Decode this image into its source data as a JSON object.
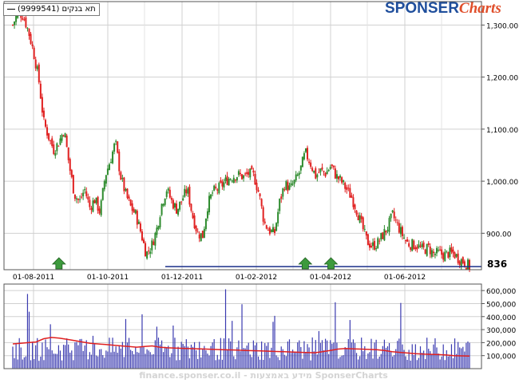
{
  "legend": {
    "label": "תא בנקים (9999541)"
  },
  "logo": {
    "part1": "SPONSER",
    "part2": "Charts"
  },
  "watermark": "finance.sponser.co.il - מידע באמצעות SponserCharts",
  "last_price_label": "836",
  "chart_data": [
    {
      "type": "candlestick",
      "name": "price",
      "title": "",
      "x_tick_labels": [
        "01-08-2011",
        "01-10-2011",
        "01-12-2011",
        "01-02-2012",
        "01-04-2012",
        "01-06-2012"
      ],
      "y_tick_labels": [
        "1,300.00",
        "1,200.00",
        "1,100.00",
        "1,000.00",
        "900.00"
      ],
      "y_ticks": [
        1300,
        1200,
        1100,
        1000,
        900
      ],
      "ylim": [
        830,
        1345
      ],
      "grid": true,
      "colors": {
        "up": "#2e8b2e",
        "down": "#e02020",
        "support_line": "#1a2f8a",
        "arrow": "#3d9a3d"
      },
      "support_line_value": 836,
      "arrows_at_index": [
        9,
        57,
        62
      ],
      "approx_close_path": [
        1300,
        1325,
        1318,
        1290,
        1250,
        1200,
        1115,
        1085,
        1060,
        1075,
        1100,
        1030,
        975,
        960,
        985,
        950,
        965,
        940,
        1010,
        1040,
        1075,
        1010,
        975,
        950,
        935,
        900,
        860,
        875,
        905,
        955,
        985,
        960,
        945,
        965,
        985,
        935,
        900,
        895,
        955,
        980,
        985,
        995,
        1005,
        1010,
        1012,
        1008,
        1015,
        1010,
        975,
        920,
        905,
        900,
        960,
        995,
        985,
        1000,
        1020,
        1055,
        1035,
        1010,
        1020,
        1015,
        1030,
        1010,
        1000,
        985,
        970,
        945,
        915,
        885,
        875,
        880,
        895,
        910,
        935,
        915,
        895,
        880,
        878,
        875,
        868,
        872,
        860,
        862,
        858,
        862,
        860,
        850,
        845,
        836
      ]
    },
    {
      "type": "bar+line",
      "name": "volume",
      "y_tick_labels": [
        "600,000",
        "500,000",
        "400,000",
        "300,000",
        "200,000",
        "100,000"
      ],
      "y_ticks": [
        600000,
        500000,
        400000,
        300000,
        200000,
        100000
      ],
      "ylim": [
        0,
        650000
      ],
      "grid": true,
      "colors": {
        "bars": "#3a3ab0",
        "moving_average": "#e02020"
      },
      "approx_moving_average_path": [
        190000,
        195000,
        200000,
        205000,
        230000,
        240000,
        235000,
        225000,
        215000,
        205000,
        195000,
        190000,
        185000,
        180000,
        175000,
        170000,
        165000,
        170000,
        175000,
        165000,
        160000,
        158000,
        156000,
        154000,
        152000,
        150000,
        148000,
        146000,
        144000,
        142000,
        140000,
        138000,
        136000,
        134000,
        132000,
        130000,
        128000,
        126000,
        124000,
        122000,
        130000,
        140000,
        150000,
        155000,
        152000,
        150000,
        148000,
        146000,
        140000,
        130000,
        125000,
        120000,
        115000,
        112000,
        110000,
        108000,
        105000,
        100000,
        98000,
        96000
      ]
    }
  ]
}
